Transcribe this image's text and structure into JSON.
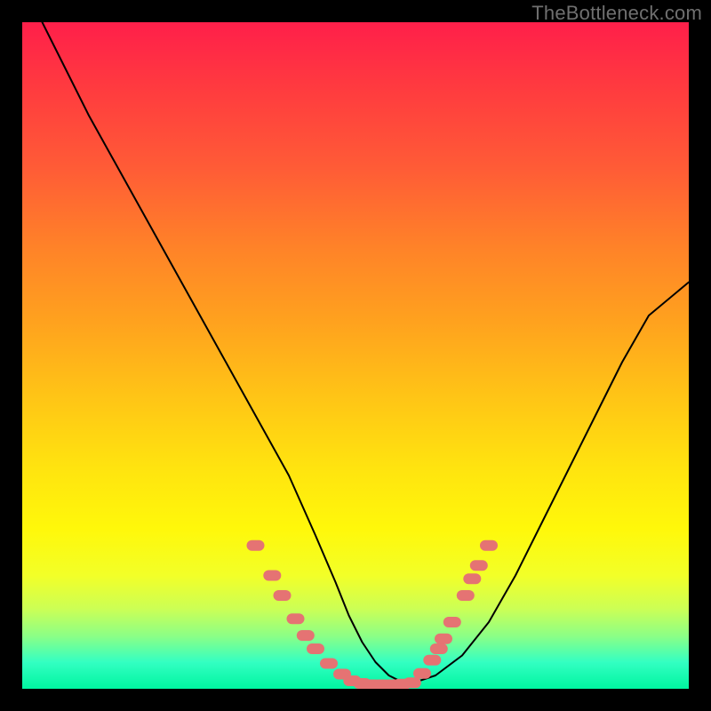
{
  "watermark": "TheBottleneck.com",
  "chart_data": {
    "type": "line",
    "title": "",
    "xlabel": "",
    "ylabel": "",
    "xlim": [
      0,
      100
    ],
    "ylim": [
      0,
      100
    ],
    "series": [
      {
        "name": "bottleneck-curve",
        "x": [
          3,
          6,
          10,
          15,
          20,
          25,
          30,
          35,
          40,
          44,
          47,
          49,
          51,
          53,
          55,
          57,
          59,
          62,
          66,
          70,
          74,
          78,
          82,
          86,
          90,
          94,
          100
        ],
        "y": [
          100,
          94,
          86,
          77,
          68,
          59,
          50,
          41,
          32,
          23,
          16,
          11,
          7,
          4,
          2,
          1,
          1,
          2,
          5,
          10,
          17,
          25,
          33,
          41,
          49,
          56,
          61
        ]
      }
    ],
    "markers": {
      "name": "highlight-dots",
      "color": "#e57373",
      "points": [
        {
          "x": 35.0,
          "y": 21.5
        },
        {
          "x": 37.5,
          "y": 17.0
        },
        {
          "x": 39.0,
          "y": 14.0
        },
        {
          "x": 41.0,
          "y": 10.5
        },
        {
          "x": 42.5,
          "y": 8.0
        },
        {
          "x": 44.0,
          "y": 6.0
        },
        {
          "x": 46.0,
          "y": 3.8
        },
        {
          "x": 48.0,
          "y": 2.2
        },
        {
          "x": 49.5,
          "y": 1.2
        },
        {
          "x": 51.0,
          "y": 0.8
        },
        {
          "x": 52.5,
          "y": 0.6
        },
        {
          "x": 54.0,
          "y": 0.6
        },
        {
          "x": 55.5,
          "y": 0.6
        },
        {
          "x": 57.0,
          "y": 0.7
        },
        {
          "x": 58.5,
          "y": 0.9
        },
        {
          "x": 60.0,
          "y": 2.3
        },
        {
          "x": 61.5,
          "y": 4.3
        },
        {
          "x": 62.5,
          "y": 6.0
        },
        {
          "x": 63.2,
          "y": 7.5
        },
        {
          "x": 64.5,
          "y": 10.0
        },
        {
          "x": 66.5,
          "y": 14.0
        },
        {
          "x": 67.5,
          "y": 16.5
        },
        {
          "x": 68.5,
          "y": 18.5
        },
        {
          "x": 70.0,
          "y": 21.5
        }
      ]
    }
  }
}
